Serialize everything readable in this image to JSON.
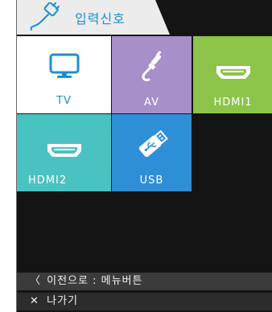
{
  "header": {
    "title": "입력신호",
    "icon": "cable-plug-icon"
  },
  "inputs": [
    {
      "label": "TV",
      "icon": "monitor-icon",
      "color": "#ffffff",
      "selected": true
    },
    {
      "label": "AV",
      "icon": "av-cable-icon",
      "color": "#a78fc9"
    },
    {
      "label": "HDMI1",
      "icon": "hdmi-port-icon",
      "color": "#8cc449"
    },
    {
      "label": "HDMI2",
      "icon": "hdmi-port-icon",
      "color": "#49c3c1"
    },
    {
      "label": "USB",
      "icon": "usb-drive-icon",
      "color": "#2f8fd6"
    }
  ],
  "footer": {
    "back_symbol": "〈",
    "back_label": "이전으로 : 메뉴버튼",
    "exit_symbol": "✕",
    "exit_label": "나가기"
  },
  "colors": {
    "accent": "#1c8fd4",
    "background": "#141414"
  }
}
